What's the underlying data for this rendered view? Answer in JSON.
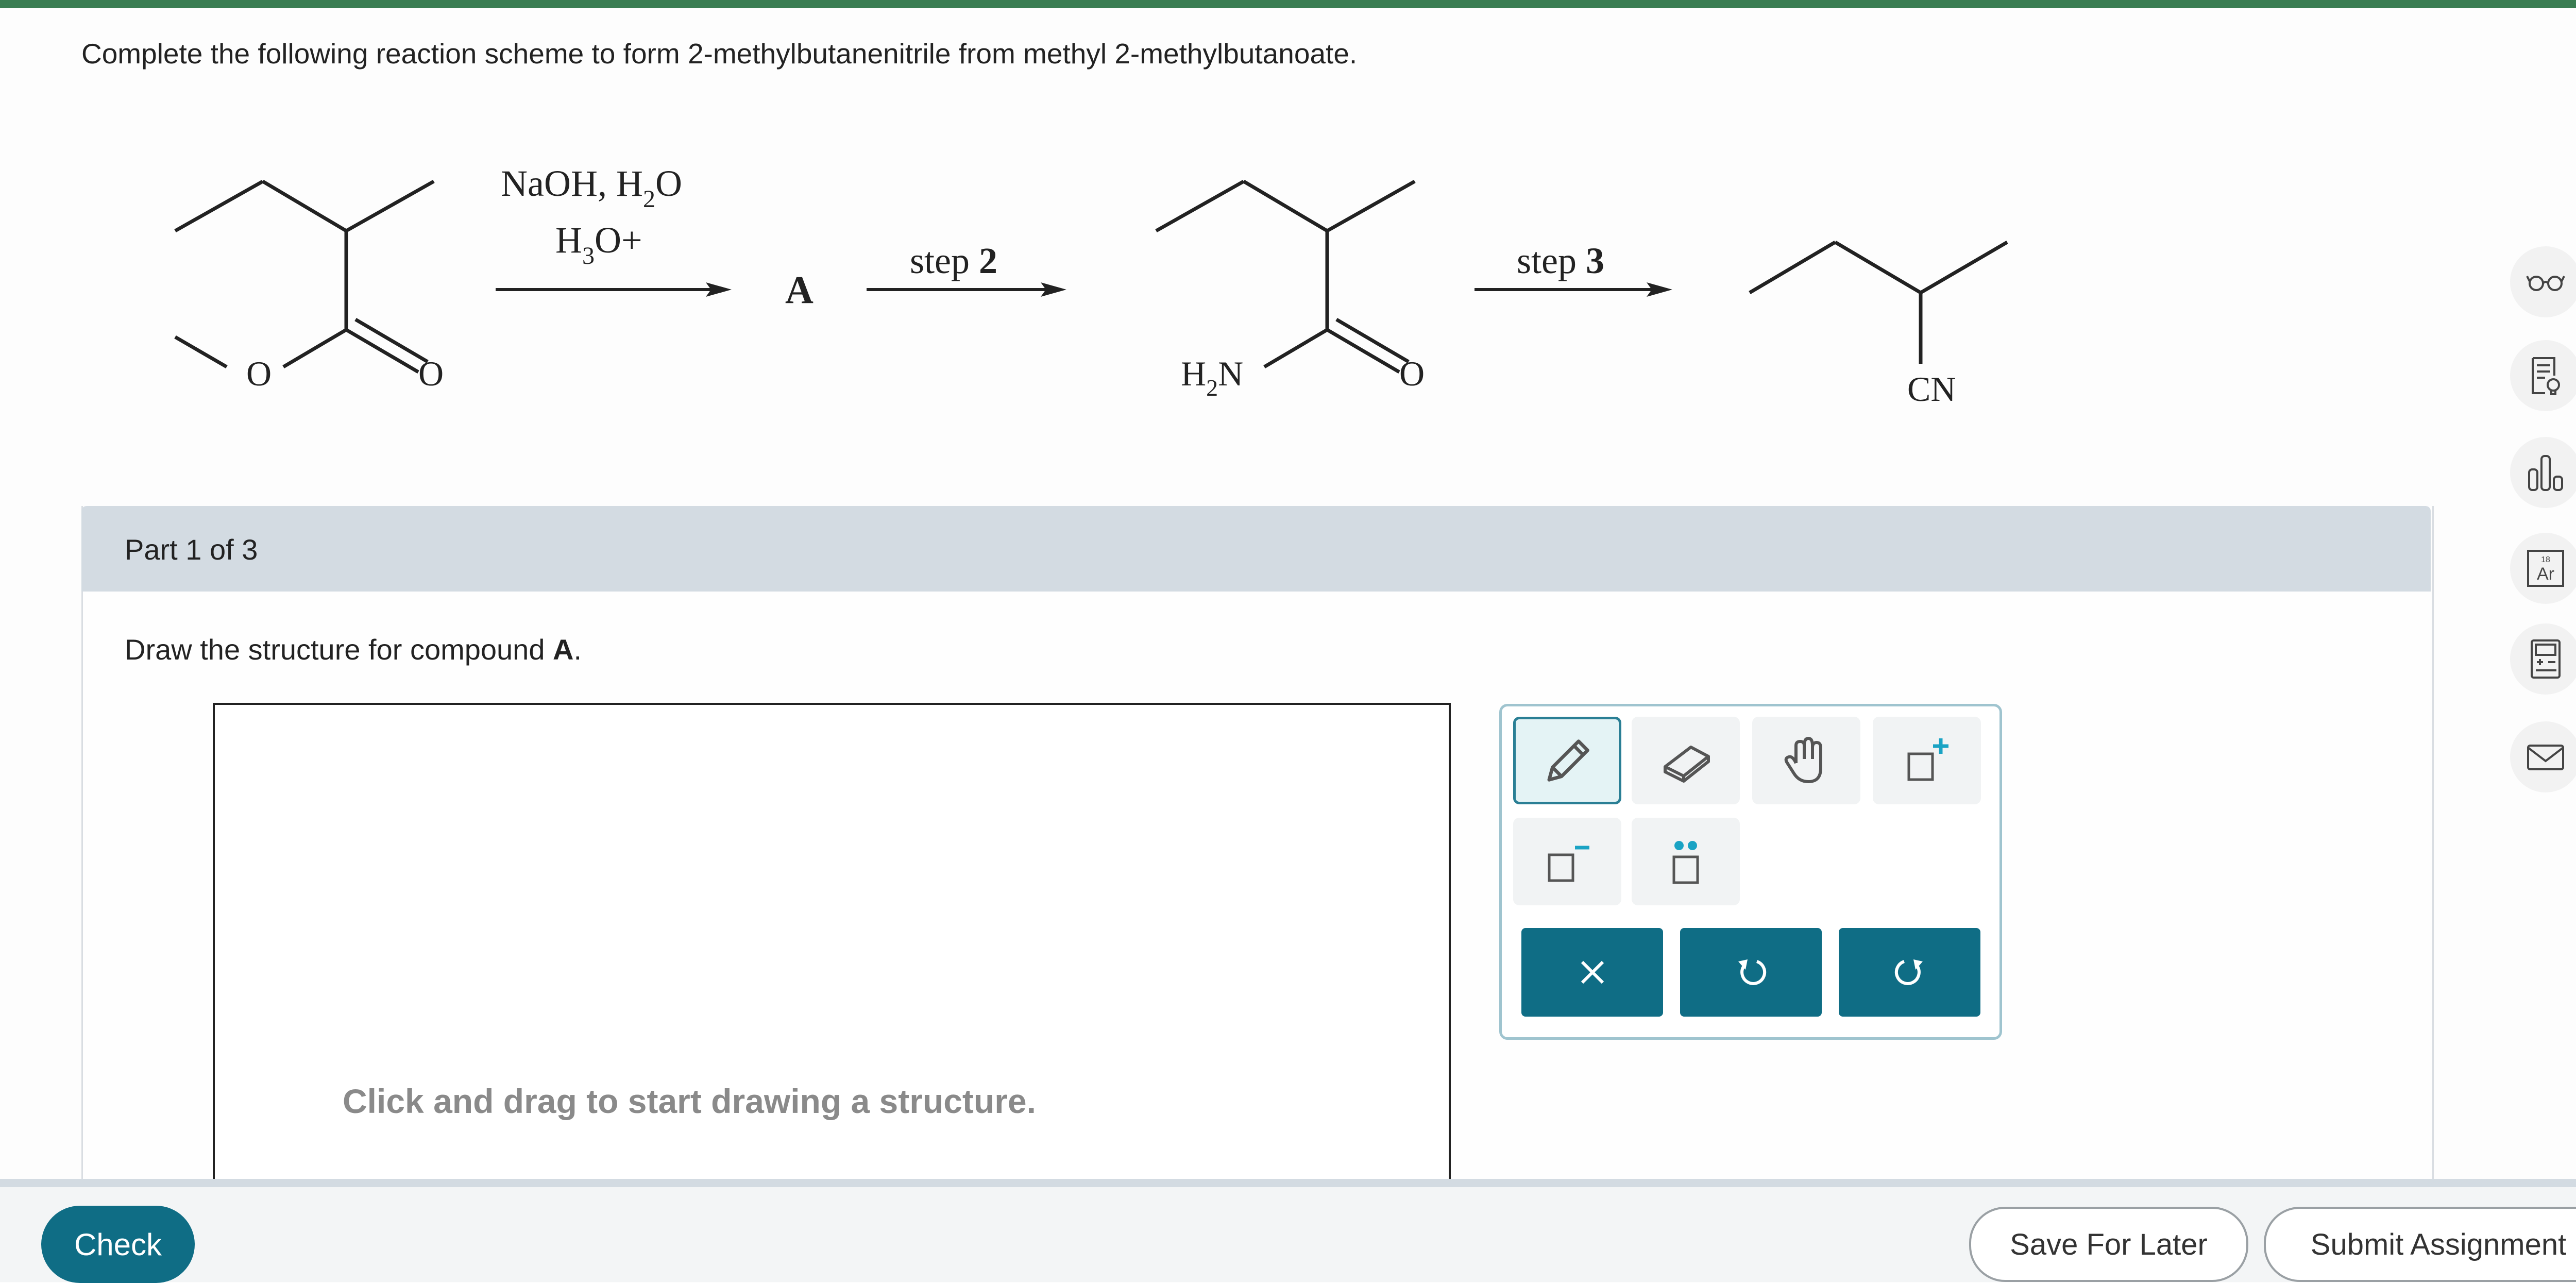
{
  "question": "Complete the following reaction scheme to form 2-methylbutanenitrile from methyl 2-methylbutanoate.",
  "scheme": {
    "reagent_line1_a": "NaOH, H",
    "reagent_line1_sub": "2",
    "reagent_line1_b": "O",
    "reagent_line2_a": "H",
    "reagent_line2_sub": "3",
    "reagent_line2_b": "O+",
    "compound_a": "A",
    "step2_word": "step",
    "step2_num": "2",
    "step3_word": "step",
    "step3_num": "3",
    "ester_o1": "O",
    "ester_o2": "O",
    "amide_h": "H",
    "amide_sub": "2",
    "amide_n": "N",
    "amide_o": "O",
    "nitrile": "CN"
  },
  "part": {
    "label": "Part 1 of 3",
    "prompt_prefix": "Draw the structure for compound ",
    "prompt_bold": "A",
    "prompt_suffix": "."
  },
  "canvas": {
    "hint": "Click and drag to start drawing a structure."
  },
  "toolbox": {
    "tools": [
      "pencil-icon",
      "eraser-icon",
      "hand-icon",
      "positive-charge-icon",
      "negative-charge-icon",
      "lone-pair-icon"
    ],
    "actions": [
      "clear-icon",
      "undo-icon",
      "redo-icon"
    ],
    "accent_color": "#0f6d85",
    "charge_color": "#1aa3c4"
  },
  "sidebar_icons": [
    "glasses-icon",
    "notes-icon",
    "chart-icon",
    "periodic-table-icon",
    "calculator-icon",
    "mail-icon"
  ],
  "footer": {
    "check": "Check",
    "save": "Save For Later",
    "submit": "Submit Assignment"
  }
}
